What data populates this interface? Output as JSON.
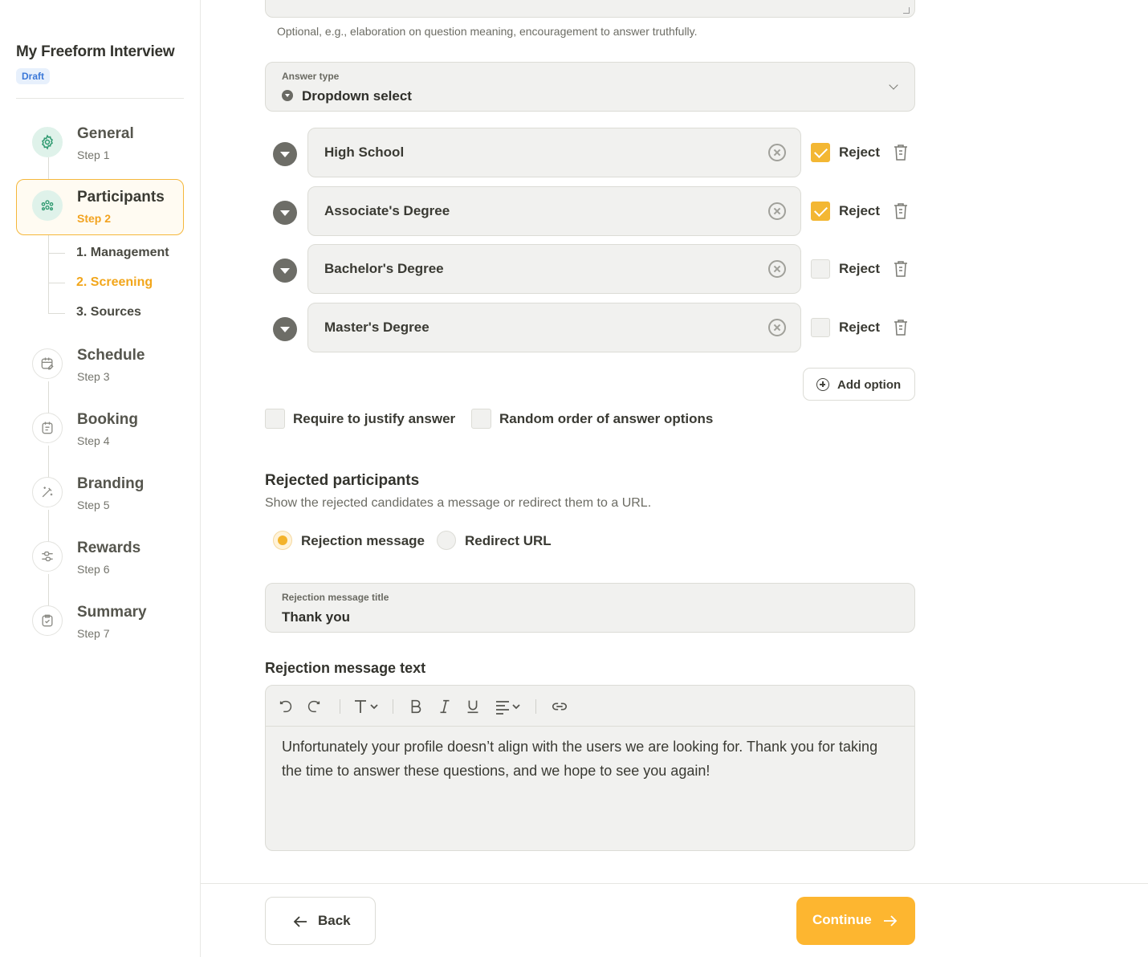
{
  "sidebar": {
    "project_title": "My Freeform Interview",
    "status_badge": "Draft",
    "steps": [
      {
        "title": "General",
        "sub": "Step 1",
        "icon": "gear-icon"
      },
      {
        "title": "Participants",
        "sub": "Step 2",
        "icon": "people-icon"
      },
      {
        "title": "Schedule",
        "sub": "Step 3",
        "icon": "calendar-edit-icon"
      },
      {
        "title": "Booking",
        "sub": "Step 4",
        "icon": "calendar-icon"
      },
      {
        "title": "Branding",
        "sub": "Step 5",
        "icon": "magic-wand-icon"
      },
      {
        "title": "Rewards",
        "sub": "Step 6",
        "icon": "sliders-icon"
      },
      {
        "title": "Summary",
        "sub": "Step 7",
        "icon": "clipboard-check-icon"
      }
    ],
    "substeps": [
      "1. Management",
      "2. Screening",
      "3. Sources"
    ]
  },
  "question": {
    "hint": "Optional, e.g., elaboration on question meaning, encouragement to answer truthfully.",
    "answer_type_label": "Answer type",
    "answer_type_value": "Dropdown select",
    "options": [
      {
        "text": "High School",
        "reject": true
      },
      {
        "text": "Associate's Degree",
        "reject": true
      },
      {
        "text": "Bachelor's Degree",
        "reject": false
      },
      {
        "text": "Master's Degree",
        "reject": false
      }
    ],
    "reject_label": "Reject",
    "add_option_label": "Add option",
    "require_justify_label": "Require to justify answer",
    "random_order_label": "Random order of answer options"
  },
  "rejected": {
    "title": "Rejected participants",
    "desc": "Show the rejected candidates a message or redirect them to a URL.",
    "radio_message": "Rejection message",
    "radio_redirect": "Redirect URL",
    "selected": "message",
    "message_title_label": "Rejection message title",
    "message_title_value": "Thank you",
    "message_text_heading": "Rejection message text",
    "message_text": "Unfortunately your profile doesn’t align with the users we are looking for. Thank you for taking the time to answer these questions, and we hope to see you again!"
  },
  "footer": {
    "back_label": "Back",
    "continue_label": "Continue"
  },
  "colors": {
    "accent": "#fdb630",
    "step_done_bg": "#dff2ea",
    "step_icon": "#2e9a70",
    "draft_badge": "#3b78d8"
  }
}
